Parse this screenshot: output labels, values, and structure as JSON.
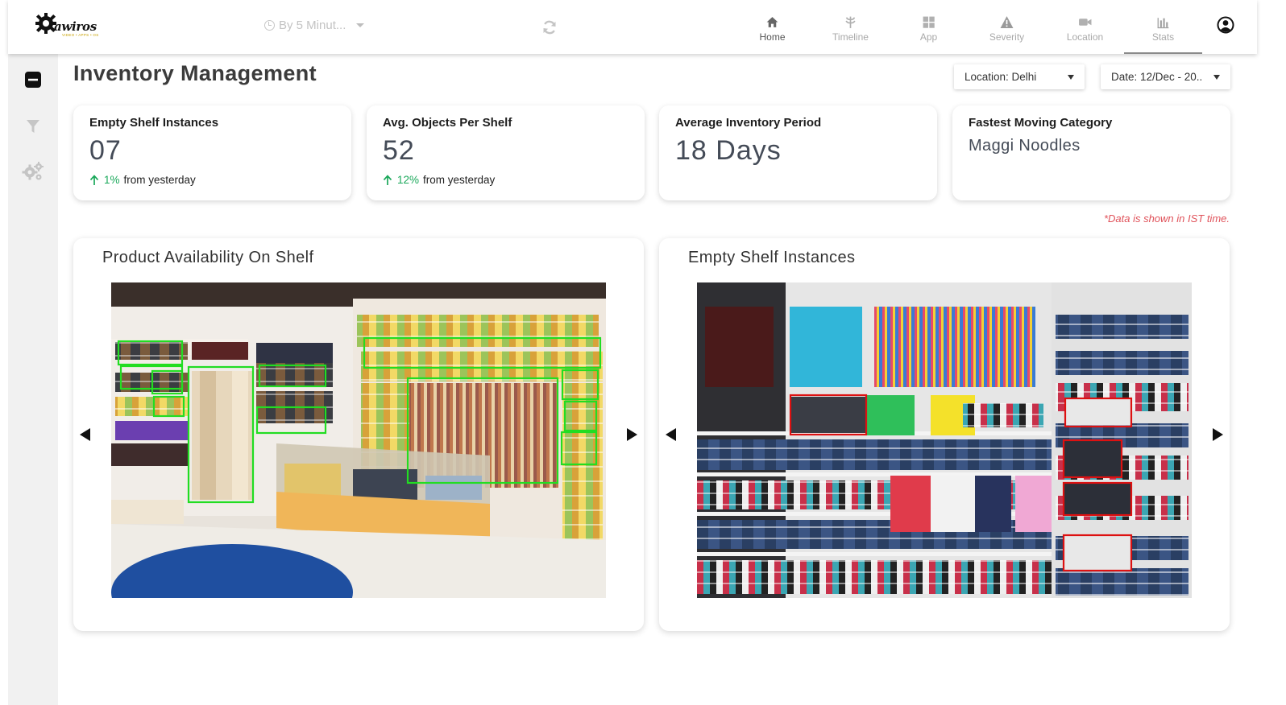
{
  "app": {
    "logo_text": "awiros",
    "logo_tagline": "VIDEO • APPS • OS",
    "time_filter": "By 5 Minut...",
    "nav": [
      {
        "label": "Home",
        "icon": "home-icon"
      },
      {
        "label": "Timeline",
        "icon": "timeline-icon"
      },
      {
        "label": "App",
        "icon": "app-grid-icon"
      },
      {
        "label": "Severity",
        "icon": "warning-icon"
      },
      {
        "label": "Location",
        "icon": "camera-icon"
      },
      {
        "label": "Stats",
        "icon": "bar-chart-icon",
        "active": true
      }
    ]
  },
  "sidebar": {
    "items": [
      "minus-square-icon",
      "filter-icon",
      "gears-icon"
    ]
  },
  "page": {
    "title": "Inventory Management",
    "location_filter": "Location: Delhi",
    "date_filter": "Date: 12/Dec - 20.."
  },
  "cards": [
    {
      "title": "Empty Shelf Instances",
      "value": "07",
      "trend_pct": "1%",
      "trend_text": "from yesterday"
    },
    {
      "title": "Avg. Objects Per Shelf",
      "value": "52",
      "trend_pct": "12%",
      "trend_text": "from yesterday"
    },
    {
      "title": "Average Inventory Period",
      "value": "18 Days"
    },
    {
      "title": "Fastest Moving Category",
      "value": "Maggi Noodles"
    }
  ],
  "note": "*Data is shown in IST time.",
  "panels": [
    {
      "title": "Product Availability On Shelf",
      "detection_color": "#22dd22"
    },
    {
      "title": "Empty Shelf Instances",
      "detection_color": "#dd1111"
    }
  ],
  "colors": {
    "accent_green": "#1aa85a",
    "note_red": "#e0525a"
  }
}
